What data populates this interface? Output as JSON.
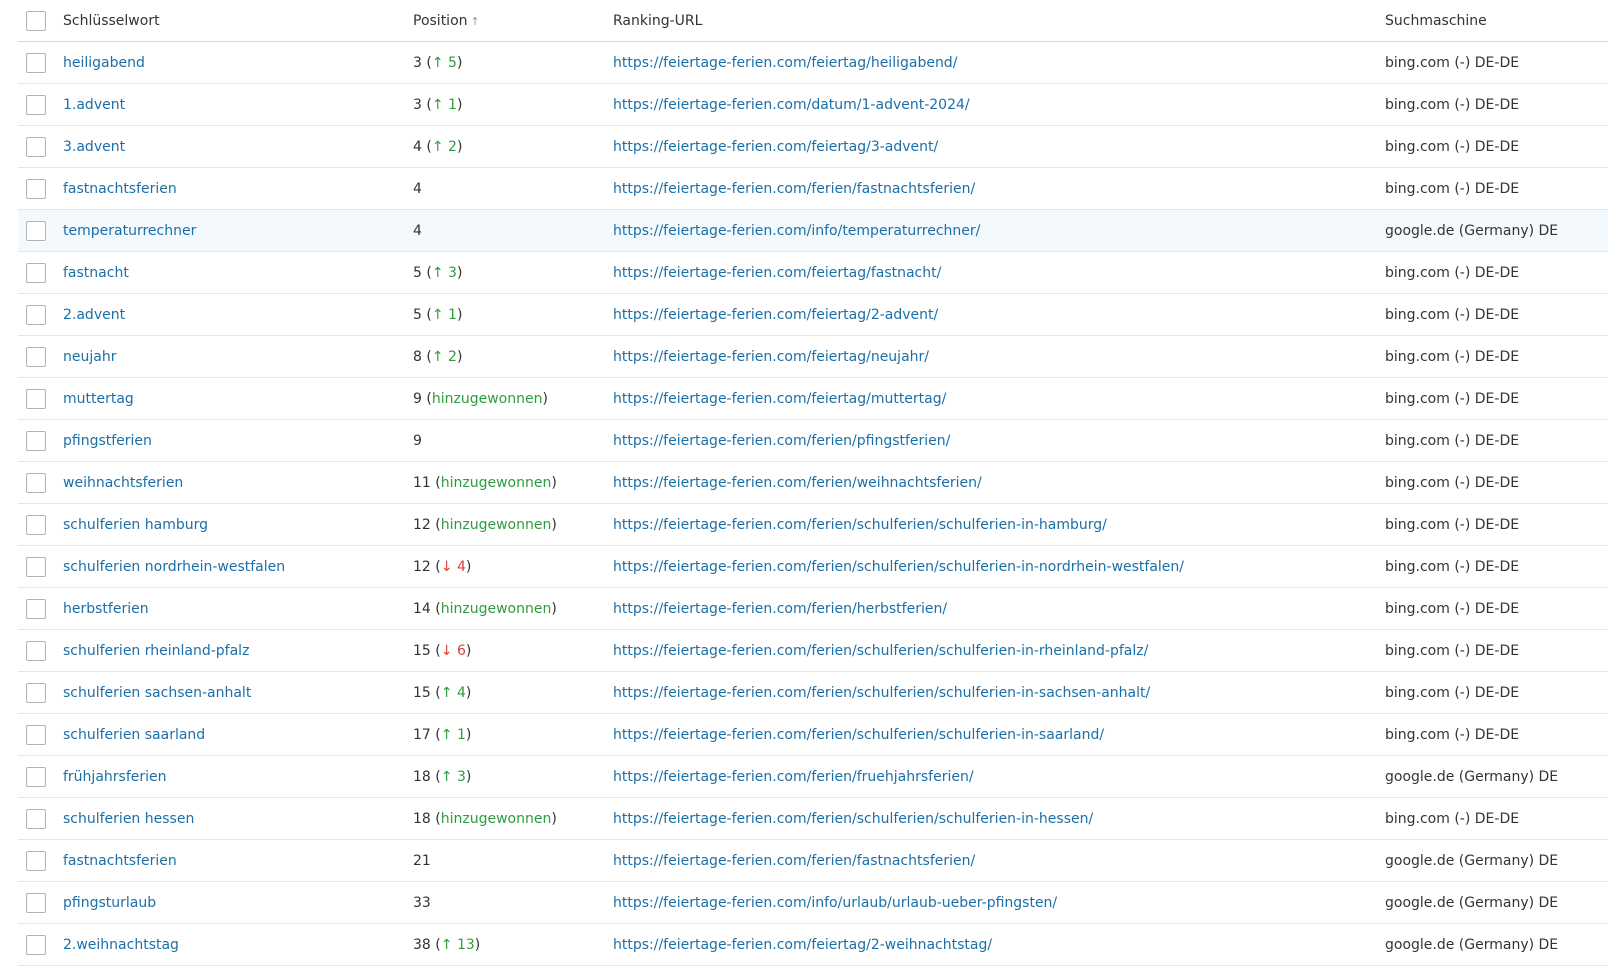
{
  "header": {
    "keyword": "Schlüsselwort",
    "position": "Position",
    "sort_arrow": "↑",
    "url": "Ranking-URL",
    "engine": "Suchmaschine"
  },
  "rows": [
    {
      "keyword": "heiligabend",
      "pos": "3",
      "change": "up",
      "delta": "5",
      "url": "https://feiertage-ferien.com/feiertag/heiligabend/",
      "engine": "bing.com (-) DE-DE"
    },
    {
      "keyword": "1.advent",
      "pos": "3",
      "change": "up",
      "delta": "1",
      "url": "https://feiertage-ferien.com/datum/1-advent-2024/",
      "engine": "bing.com (-) DE-DE"
    },
    {
      "keyword": "3.advent",
      "pos": "4",
      "change": "up",
      "delta": "2",
      "url": "https://feiertage-ferien.com/feiertag/3-advent/",
      "engine": "bing.com (-) DE-DE"
    },
    {
      "keyword": "fastnachtsferien",
      "pos": "4",
      "change": "none",
      "delta": "",
      "url": "https://feiertage-ferien.com/ferien/fastnachtsferien/",
      "engine": "bing.com (-) DE-DE"
    },
    {
      "keyword": "temperaturrechner",
      "pos": "4",
      "change": "none",
      "delta": "",
      "url": "https://feiertage-ferien.com/info/temperaturrechner/",
      "engine": "google.de (Germany) DE",
      "highlight": true
    },
    {
      "keyword": "fastnacht",
      "pos": "5",
      "change": "up",
      "delta": "3",
      "url": "https://feiertage-ferien.com/feiertag/fastnacht/",
      "engine": "bing.com (-) DE-DE"
    },
    {
      "keyword": "2.advent",
      "pos": "5",
      "change": "up",
      "delta": "1",
      "url": "https://feiertage-ferien.com/feiertag/2-advent/",
      "engine": "bing.com (-) DE-DE"
    },
    {
      "keyword": "neujahr",
      "pos": "8",
      "change": "up",
      "delta": "2",
      "url": "https://feiertage-ferien.com/feiertag/neujahr/",
      "engine": "bing.com (-) DE-DE"
    },
    {
      "keyword": "muttertag",
      "pos": "9",
      "change": "gained",
      "delta": "hinzugewonnen",
      "url": "https://feiertage-ferien.com/feiertag/muttertag/",
      "engine": "bing.com (-) DE-DE"
    },
    {
      "keyword": "pfingstferien",
      "pos": "9",
      "change": "none",
      "delta": "",
      "url": "https://feiertage-ferien.com/ferien/pfingstferien/",
      "engine": "bing.com (-) DE-DE"
    },
    {
      "keyword": "weihnachtsferien",
      "pos": "11",
      "change": "gained",
      "delta": "hinzugewonnen",
      "url": "https://feiertage-ferien.com/ferien/weihnachtsferien/",
      "engine": "bing.com (-) DE-DE"
    },
    {
      "keyword": "schulferien hamburg",
      "pos": "12",
      "change": "gained",
      "delta": "hinzugewonnen",
      "url": "https://feiertage-ferien.com/ferien/schulferien/schulferien-in-hamburg/",
      "engine": "bing.com (-) DE-DE"
    },
    {
      "keyword": "schulferien nordrhein-westfalen",
      "pos": "12",
      "change": "down",
      "delta": "4",
      "url": "https://feiertage-ferien.com/ferien/schulferien/schulferien-in-nordrhein-westfalen/",
      "engine": "bing.com (-) DE-DE"
    },
    {
      "keyword": "herbstferien",
      "pos": "14",
      "change": "gained",
      "delta": "hinzugewonnen",
      "url": "https://feiertage-ferien.com/ferien/herbstferien/",
      "engine": "bing.com (-) DE-DE"
    },
    {
      "keyword": "schulferien rheinland-pfalz",
      "pos": "15",
      "change": "down",
      "delta": "6",
      "url": "https://feiertage-ferien.com/ferien/schulferien/schulferien-in-rheinland-pfalz/",
      "engine": "bing.com (-) DE-DE"
    },
    {
      "keyword": "schulferien sachsen-anhalt",
      "pos": "15",
      "change": "up",
      "delta": "4",
      "url": "https://feiertage-ferien.com/ferien/schulferien/schulferien-in-sachsen-anhalt/",
      "engine": "bing.com (-) DE-DE"
    },
    {
      "keyword": "schulferien saarland",
      "pos": "17",
      "change": "up",
      "delta": "1",
      "url": "https://feiertage-ferien.com/ferien/schulferien/schulferien-in-saarland/",
      "engine": "bing.com (-) DE-DE"
    },
    {
      "keyword": "frühjahrsferien",
      "pos": "18",
      "change": "up",
      "delta": "3",
      "url": "https://feiertage-ferien.com/ferien/fruehjahrsferien/",
      "engine": "google.de (Germany) DE"
    },
    {
      "keyword": "schulferien hessen",
      "pos": "18",
      "change": "gained",
      "delta": "hinzugewonnen",
      "url": "https://feiertage-ferien.com/ferien/schulferien/schulferien-in-hessen/",
      "engine": "bing.com (-) DE-DE"
    },
    {
      "keyword": "fastnachtsferien",
      "pos": "21",
      "change": "none",
      "delta": "",
      "url": "https://feiertage-ferien.com/ferien/fastnachtsferien/",
      "engine": "google.de (Germany) DE"
    },
    {
      "keyword": "pfingsturlaub",
      "pos": "33",
      "change": "none",
      "delta": "",
      "url": "https://feiertage-ferien.com/info/urlaub/urlaub-ueber-pfingsten/",
      "engine": "google.de (Germany) DE"
    },
    {
      "keyword": "2.weihnachtstag",
      "pos": "38",
      "change": "up",
      "delta": "13",
      "url": "https://feiertage-ferien.com/feiertag/2-weihnachtstag/",
      "engine": "google.de (Germany) DE"
    }
  ],
  "colors": {
    "link": "#1b6fa8",
    "up": "#2e9c3e",
    "down": "#d9423b",
    "highlight_row": "#f3f9fc"
  }
}
